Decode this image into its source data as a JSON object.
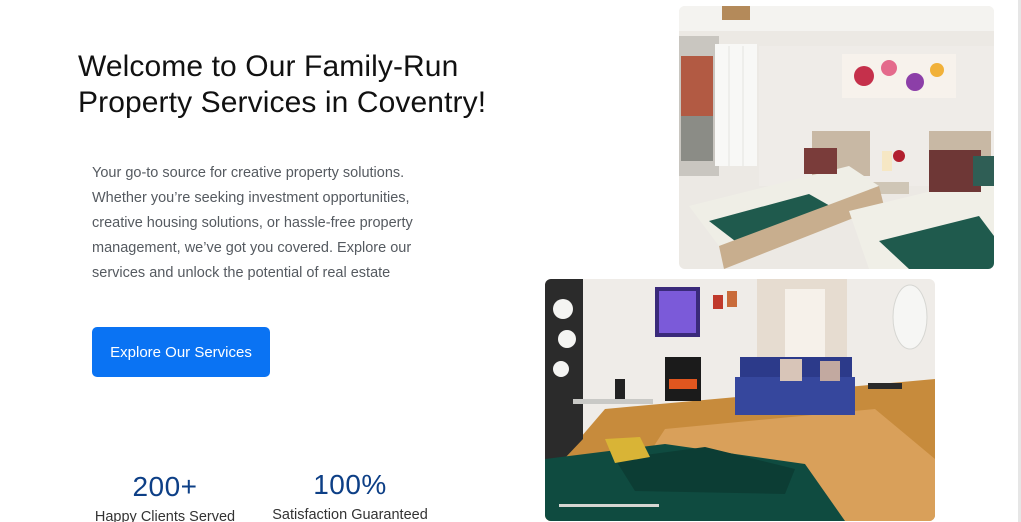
{
  "hero": {
    "title": "Welcome to Our Family-Run Property Services in Coventry!",
    "description": "Your go-to source for creative property solutions. Whether you’re seeking investment opportunities, creative housing solutions, or hassle-free property management, we’ve got you covered. Explore our services and unlock the potential of real estate",
    "cta_label": "Explore Our Services"
  },
  "stats": [
    {
      "value": "200+",
      "label": "Happy Clients Served"
    },
    {
      "value": "100%",
      "label": "Satisfaction Guaranteed"
    }
  ],
  "colors": {
    "accent": "#0a73f3",
    "stat_value": "#0d3f86",
    "body_text": "#555a60"
  },
  "images": [
    {
      "subject": "twin bedroom photo"
    },
    {
      "subject": "living room photo"
    }
  ]
}
